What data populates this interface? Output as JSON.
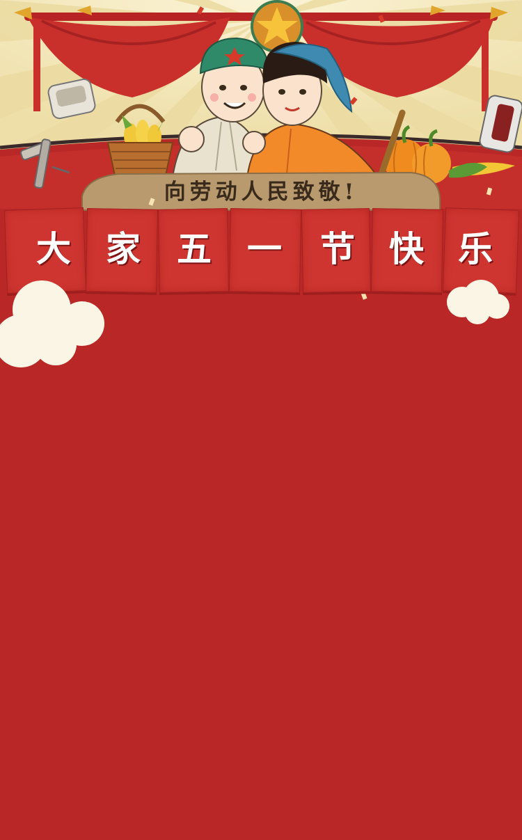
{
  "slogan": "向劳动人民致敬!",
  "banner": {
    "chars": [
      "大",
      "家",
      "五",
      "一",
      "节",
      "快",
      "乐"
    ]
  },
  "colors": {
    "background": "#b92727",
    "banner_tile": "#cf3530",
    "sign_board": "#b89a6e",
    "curtain": "#c9302c",
    "rays_light": "#f6ecc9"
  },
  "illustrations": [
    "star-emblem-icon",
    "soldier-character",
    "farm-woman-character",
    "corn-basket-icon",
    "pumpkin-icon",
    "corn-cob-icon",
    "foot-spa-icon",
    "massage-chair-icon",
    "massager-icon",
    "cloud-left",
    "cloud-right"
  ]
}
